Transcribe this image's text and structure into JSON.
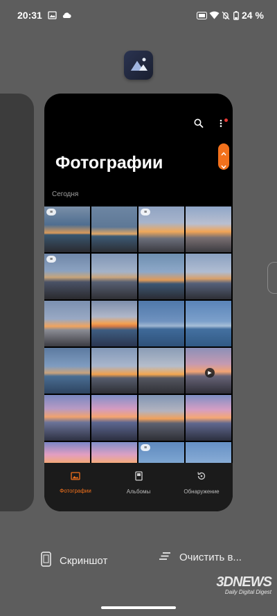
{
  "status_bar": {
    "time": "20:31",
    "battery_percent": "24 %",
    "icons": [
      "gallery-icon",
      "cloud-icon",
      "hd-icon",
      "wifi-icon",
      "mute-icon",
      "battery-icon"
    ]
  },
  "recent_app": {
    "title": "Фотографии",
    "section": "Сегодня",
    "nav": [
      {
        "label": "Фотографии",
        "icon": "photo-icon",
        "active": true
      },
      {
        "label": "Альбомы",
        "icon": "album-icon",
        "active": false
      },
      {
        "label": "Обнаружение",
        "icon": "discover-icon",
        "active": false
      }
    ],
    "accent_color": "#f2711c"
  },
  "actions": {
    "screenshot_label": "Скриншот",
    "clear_label": "Очистить в..."
  },
  "watermark": {
    "logo": "3DNEWS",
    "tagline": "Daily Digital Digest"
  }
}
